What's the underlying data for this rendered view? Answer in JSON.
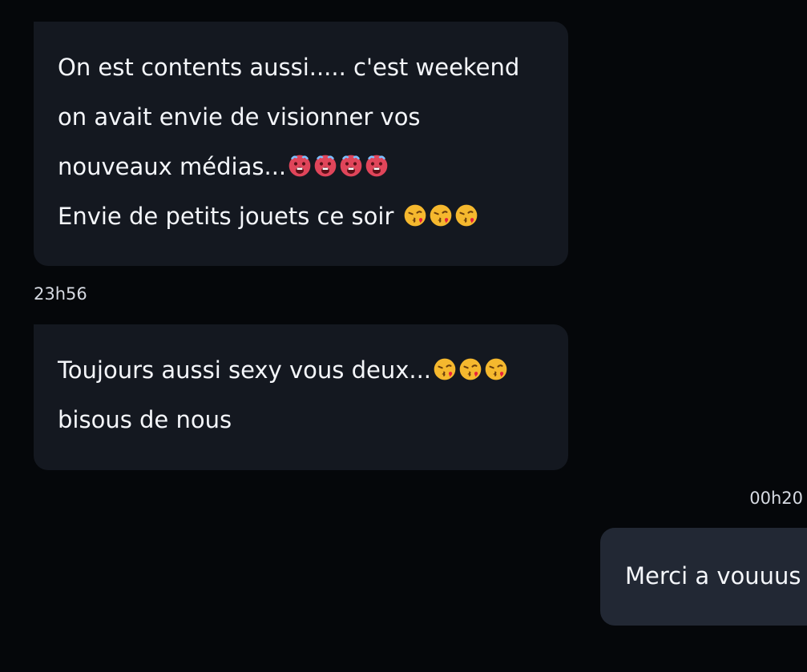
{
  "conversation": {
    "messages": [
      {
        "direction": "received",
        "lines": [
          {
            "text": "On est contents aussi..... c'est weekend",
            "emoji": [],
            "emoji_name": ""
          },
          {
            "text": "on avait envie de visionner vos",
            "emoji": [],
            "emoji_name": ""
          },
          {
            "text": "nouveaux médias...",
            "emoji": [
              "hot-face-emoji",
              "hot-face-emoji",
              "hot-face-emoji",
              "hot-face-emoji"
            ],
            "emoji_name": "hot-face-emoji"
          },
          {
            "text": "Envie de petits jouets ce soir ",
            "emoji": [
              "kiss-face-emoji",
              "kiss-face-emoji",
              "kiss-face-emoji"
            ],
            "emoji_name": "kiss-face-emoji"
          }
        ]
      },
      {
        "direction": "received",
        "timestamp": "23h56",
        "lines": [
          {
            "text": "Toujours aussi sexy vous deux...",
            "emoji": [
              "kiss-face-emoji",
              "kiss-face-emoji",
              "kiss-face-emoji"
            ],
            "emoji_name": "kiss-face-emoji"
          },
          {
            "text": "bisous de nous",
            "emoji": [],
            "emoji_name": ""
          }
        ]
      },
      {
        "direction": "sent",
        "timestamp": "00h20",
        "lines": [
          {
            "text": "Merci a vouuus",
            "emoji": [],
            "emoji_name": ""
          }
        ]
      }
    ]
  },
  "colors": {
    "background": "#05070a",
    "received_bubble": "#141820",
    "sent_bubble": "#222834",
    "text": "#f4f6fa",
    "timestamp": "#d6dae2",
    "hot_face": "#e0455a",
    "kiss_face": "#f5b82e",
    "heart": "#e8203b"
  }
}
